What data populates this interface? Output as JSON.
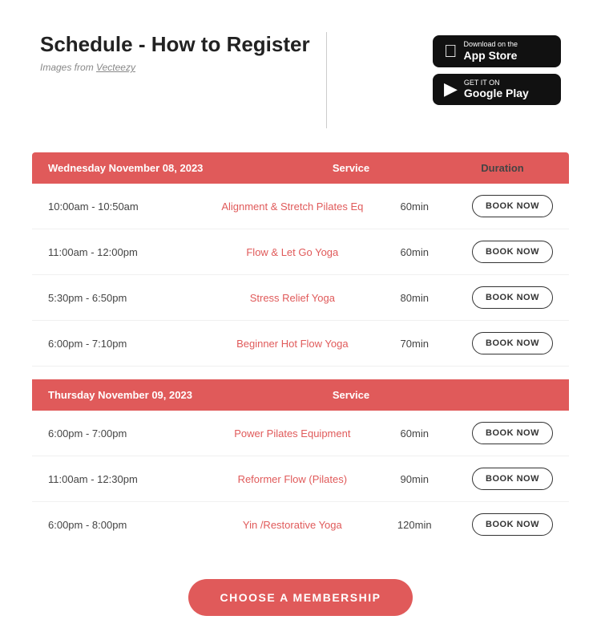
{
  "header": {
    "title": "Schedule - How to Register",
    "attribution_text": "Images from ",
    "attribution_link": "Vecteezy",
    "divider_visible": true
  },
  "app_stores": {
    "apple": {
      "pre_label": "Download on the",
      "label": "App Store",
      "icon": ""
    },
    "google": {
      "pre_label": "GET IT ON",
      "label": "Google Play",
      "icon": "▶"
    }
  },
  "schedule": [
    {
      "day": "Wednesday November 08, 2023",
      "service_col": "Service",
      "duration_col": "Duration",
      "classes": [
        {
          "time": "10:00am - 10:50am",
          "service": "Alignment & Stretch Pilates Eq",
          "duration": "60min",
          "book_label": "BOOK NOW"
        },
        {
          "time": "11:00am - 12:00pm",
          "service": "Flow & Let Go Yoga",
          "duration": "60min",
          "book_label": "BOOK NOW"
        },
        {
          "time": "5:30pm - 6:50pm",
          "service": "Stress Relief Yoga",
          "duration": "80min",
          "book_label": "BOOK NOW"
        },
        {
          "time": "6:00pm - 7:10pm",
          "service": "Beginner Hot Flow Yoga",
          "duration": "70min",
          "book_label": "BOOK NOW"
        }
      ]
    },
    {
      "day": "Thursday November 09, 2023",
      "service_col": "Service",
      "duration_col": "",
      "classes": [
        {
          "time": "6:00pm - 7:00pm",
          "service": "Power Pilates Equipment",
          "duration": "60min",
          "book_label": "BOOK NOW"
        },
        {
          "time": "11:00am - 12:30pm",
          "service": "Reformer Flow (Pilates)",
          "duration": "90min",
          "book_label": "BOOK NOW"
        },
        {
          "time": "6:00pm - 8:00pm",
          "service": "Yin /Restorative Yoga",
          "duration": "120min",
          "book_label": "BOOK NOW"
        }
      ]
    }
  ],
  "membership": {
    "button_label": "CHOOSE A MEMBERSHIP"
  }
}
